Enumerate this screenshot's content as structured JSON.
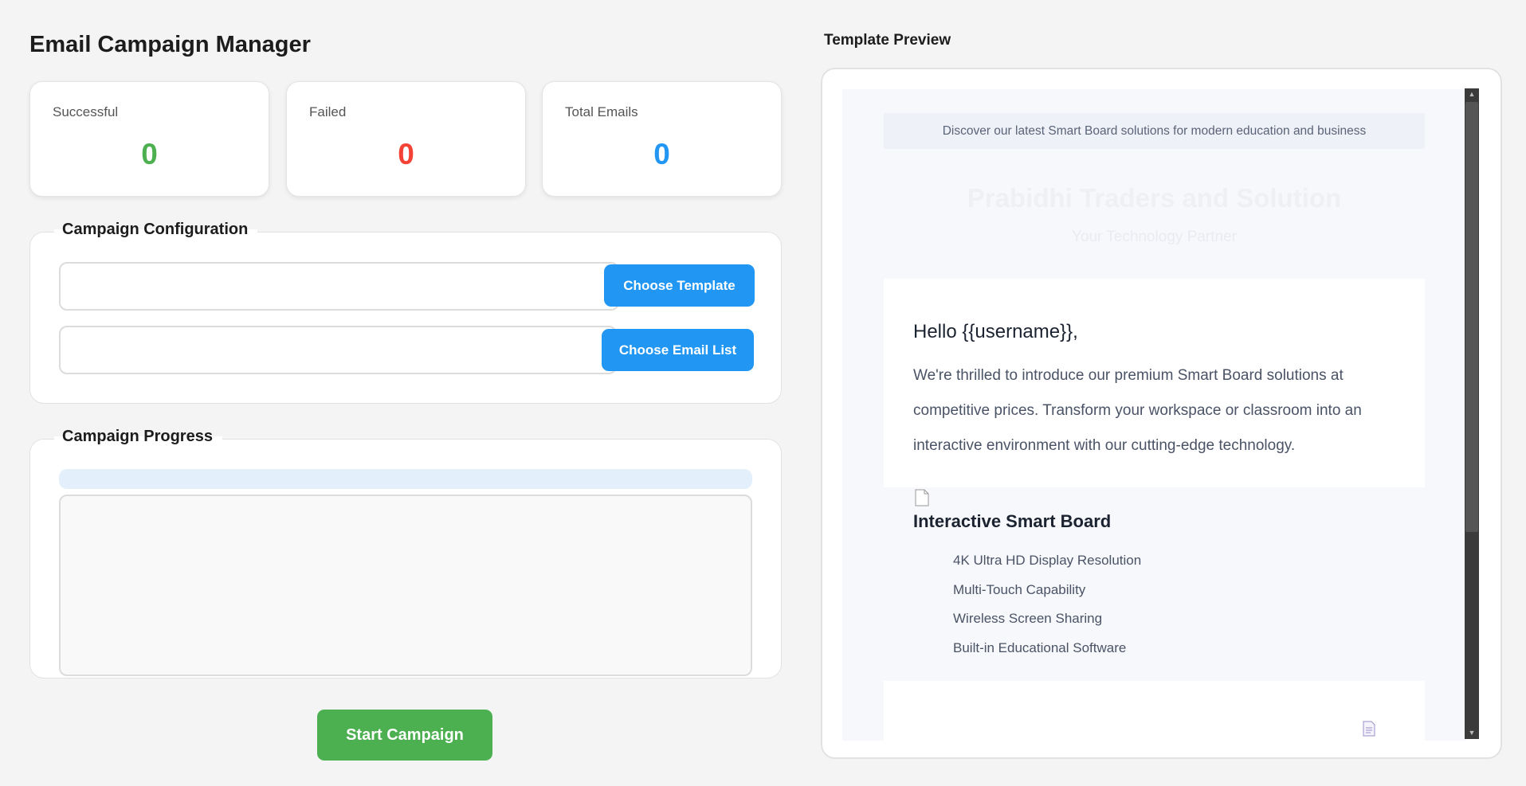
{
  "app": {
    "title": "Email Campaign Manager"
  },
  "stats": {
    "successful": {
      "label": "Successful",
      "value": "0",
      "color": "#4caf50"
    },
    "failed": {
      "label": "Failed",
      "value": "0",
      "color": "#f44336"
    },
    "total": {
      "label": "Total Emails",
      "value": "0",
      "color": "#2196f3"
    }
  },
  "config": {
    "legend": "Campaign Configuration",
    "template_path": "",
    "email_list_path": "",
    "choose_template_label": "Choose Template",
    "choose_email_list_label": "Choose Email List"
  },
  "progress": {
    "legend": "Campaign Progress",
    "fraction": 0,
    "log_text": ""
  },
  "start_button_label": "Start Campaign",
  "preview": {
    "title": "Template Preview",
    "banner": "Discover our latest Smart Board solutions for modern education and business",
    "brand": "Prabidhi Traders and Solution",
    "tagline": "Your Technology Partner",
    "greeting": "Hello {{username}},",
    "intro": "We're thrilled to introduce our premium Smart Board solutions at competitive prices. Transform your workspace or classroom into an interactive environment with our cutting-edge technology.",
    "product_title": "Interactive Smart Board",
    "features": [
      "4K Ultra HD Display Resolution",
      "Multi-Touch Capability",
      "Wireless Screen Sharing",
      "Built-in Educational Software"
    ]
  },
  "colors": {
    "accent_blue": "#2196f3",
    "accent_green": "#4caf50",
    "error_red": "#f44336"
  }
}
